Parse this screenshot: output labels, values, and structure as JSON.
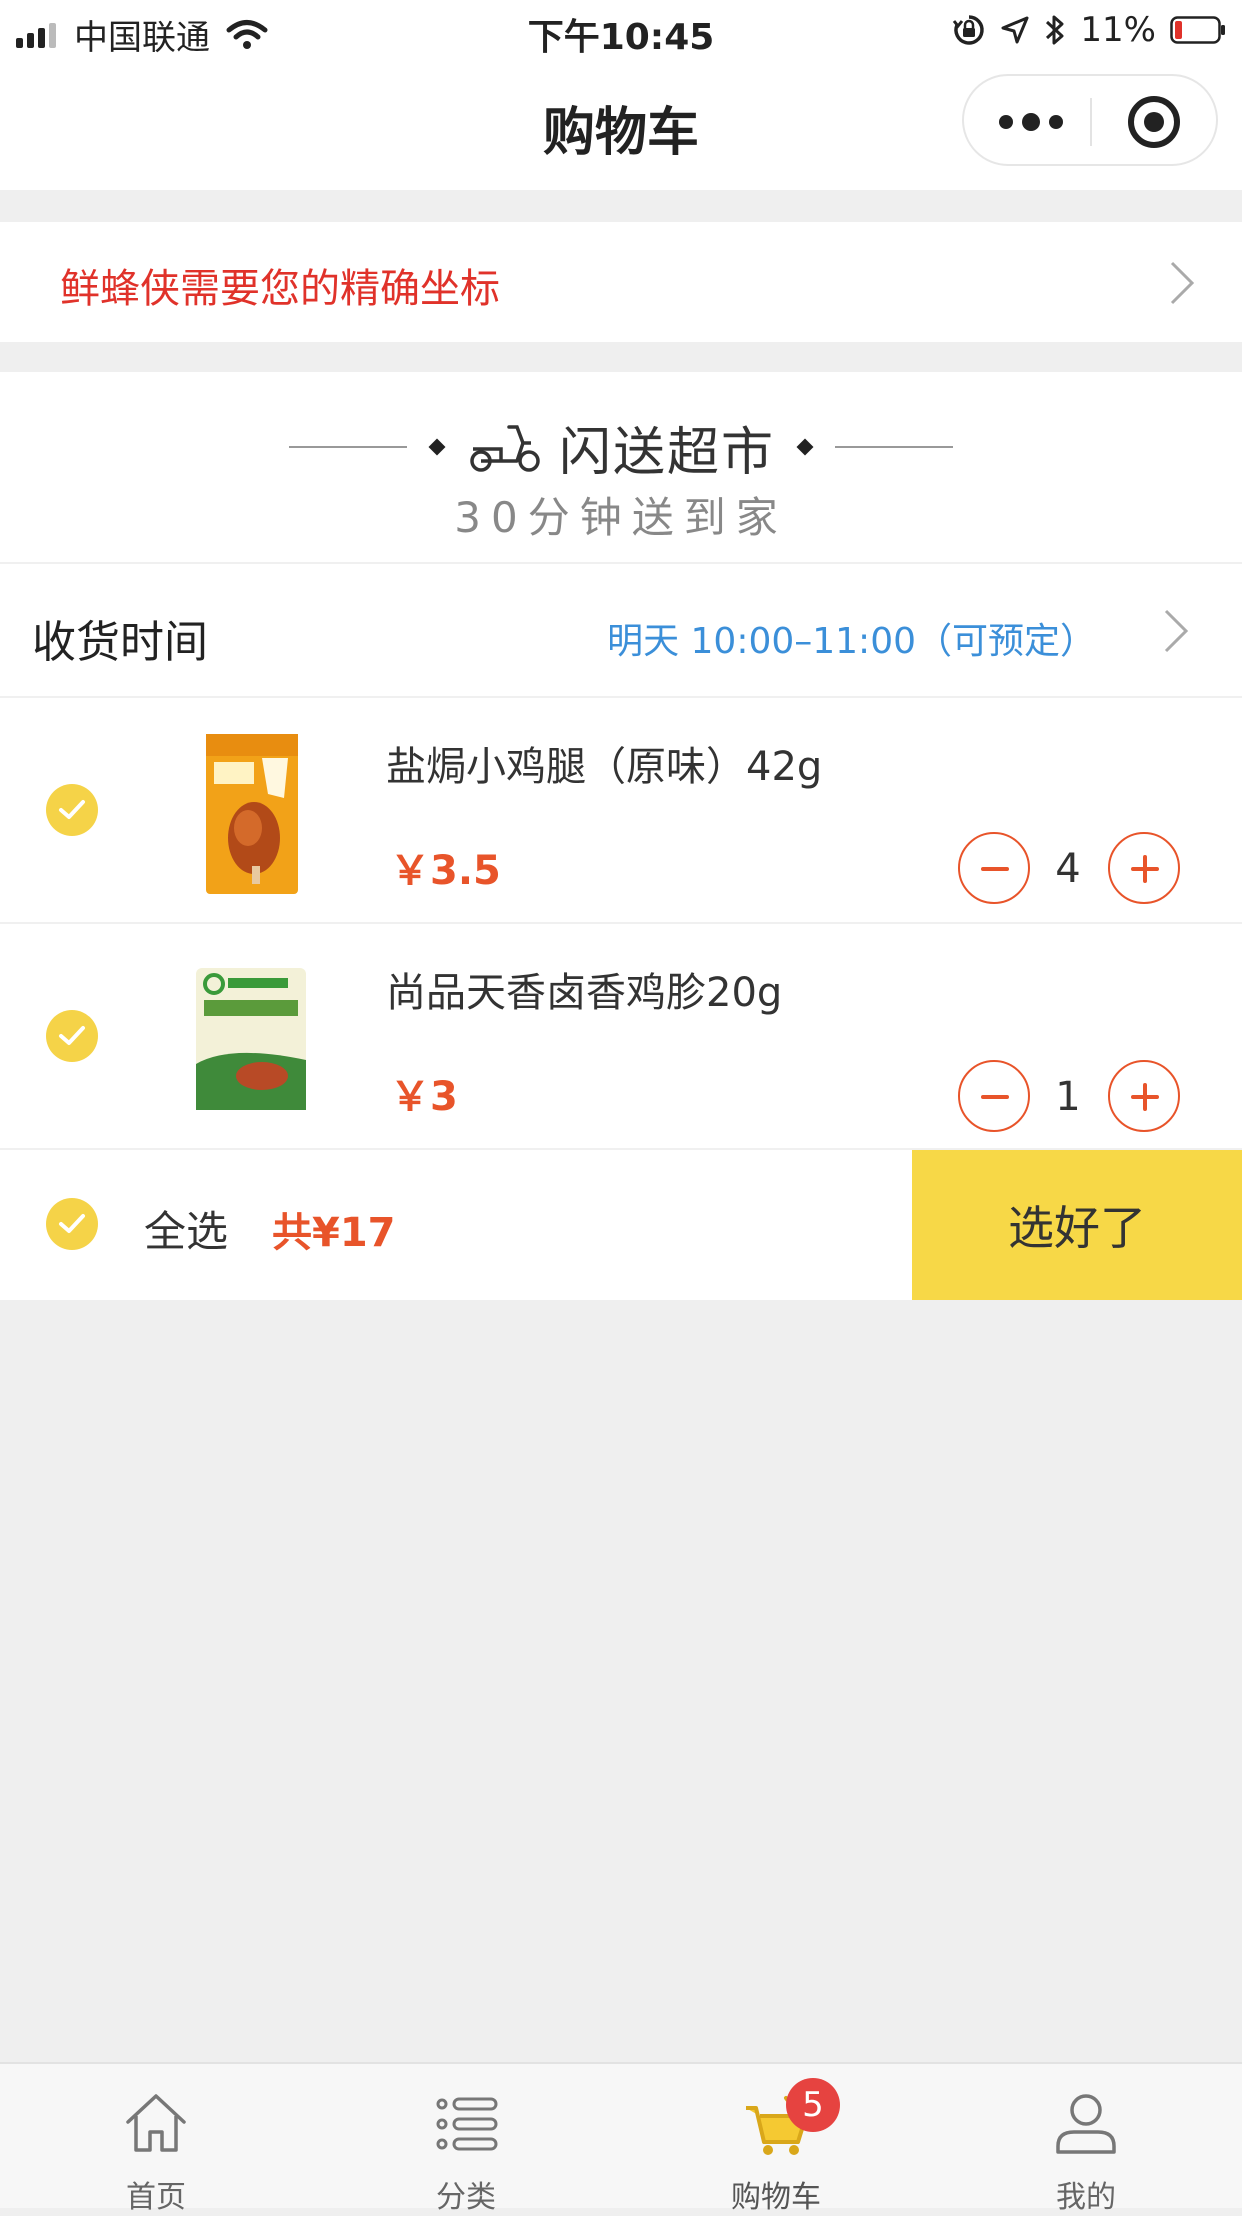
{
  "status_bar": {
    "carrier": "中国联通",
    "time": "下午10:45",
    "battery": "11%"
  },
  "nav": {
    "title": "购物车"
  },
  "location_banner": {
    "text": "鲜蜂侠需要您的精确坐标"
  },
  "store": {
    "name": "闪送超市",
    "subtitle": "30分钟送到家"
  },
  "delivery": {
    "label": "收货时间",
    "value": "明天 10:00–11:00（可预定）"
  },
  "cart_items": [
    {
      "name": "盐焗小鸡腿（原味）42g",
      "price": "￥3.5",
      "quantity": "4",
      "checked": true
    },
    {
      "name": "尚品天香卤香鸡胗20g",
      "price": "￥3",
      "quantity": "1",
      "checked": true
    }
  ],
  "checkout": {
    "select_all": "全选",
    "total": "共¥17",
    "button": "选好了"
  },
  "tabs": [
    {
      "label": "首页",
      "icon": "home-icon"
    },
    {
      "label": "分类",
      "icon": "list-icon"
    },
    {
      "label": "购物车",
      "icon": "cart-icon",
      "active": true,
      "badge": "5"
    },
    {
      "label": "我的",
      "icon": "user-icon"
    }
  ],
  "colors": {
    "accent_yellow": "#f7d847",
    "price_orange": "#e8542a",
    "alert_red": "#e0322a",
    "link_blue": "#3b8fd9",
    "badge_red": "#e64340"
  }
}
